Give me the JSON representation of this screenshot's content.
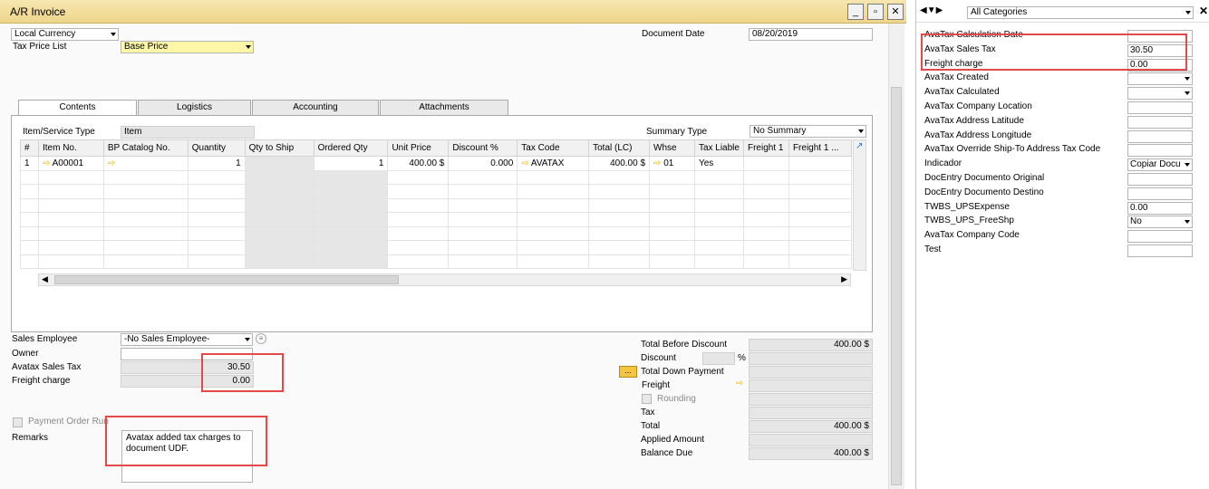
{
  "window": {
    "title": "A/R Invoice"
  },
  "header": {
    "currency": "Local Currency",
    "tax_price_list_label": "Tax Price List",
    "tax_price_list_value": "Base Price",
    "document_date_label": "Document Date",
    "document_date_value": "08/20/2019"
  },
  "tabs": [
    "Contents",
    "Logistics",
    "Accounting",
    "Attachments"
  ],
  "contents": {
    "item_type_label": "Item/Service Type",
    "item_type_value": "Item",
    "summary_type_label": "Summary Type",
    "summary_type_value": "No Summary",
    "columns": [
      "#",
      "Item No.",
      "BP Catalog No.",
      "Quantity",
      "Qty to Ship",
      "Ordered Qty",
      "Unit Price",
      "Discount %",
      "Tax Code",
      "Total (LC)",
      "Whse",
      "Tax Liable",
      "Freight 1",
      "Freight 1 ..."
    ],
    "row1": {
      "num": "1",
      "item": "A00001",
      "qty": "1",
      "ordered": "1",
      "unit_price": "400.00 $",
      "discount": "0.000",
      "tax_code": "AVATAX",
      "total": "400.00 $",
      "whse": "01",
      "tax_liable": "Yes"
    }
  },
  "footer_left": {
    "sales_employee_label": "Sales Employee",
    "sales_employee_value": "-No Sales Employee-",
    "owner_label": "Owner",
    "avatax_label": "Avatax Sales Tax",
    "avatax_value": "30.50",
    "freight_label": "Freight charge",
    "freight_value": "0.00",
    "payment_order_label": "Payment Order Run",
    "remarks_label": "Remarks",
    "remarks_value": "Avatax added tax charges to document UDF."
  },
  "totals": {
    "total_before_discount_label": "Total Before Discount",
    "total_before_discount_value": "400.00 $",
    "discount_label": "Discount",
    "percent": "%",
    "total_down_payment_label": "Total Down Payment",
    "freight_label": "Freight",
    "rounding_label": "Rounding",
    "tax_label": "Tax",
    "total_label": "Total",
    "total_value": "400.00 $",
    "applied_label": "Applied Amount",
    "balance_due_label": "Balance Due",
    "balance_due_value": "400.00 $",
    "ellipsis": "..."
  },
  "udf_panel": {
    "category": "All Categories",
    "fields": [
      {
        "label": "AvaTax Calculation Date",
        "value": ""
      },
      {
        "label": "AvaTax Sales Tax",
        "value": "30.50"
      },
      {
        "label": "Freight charge",
        "value": "0.00"
      },
      {
        "label": "AvaTax Created",
        "value": ""
      },
      {
        "label": "AvaTax Calculated",
        "value": ""
      },
      {
        "label": "AvaTax Company Location",
        "value": ""
      },
      {
        "label": "AvaTax Address Latitude",
        "value": ""
      },
      {
        "label": "AvaTax Address Longitude",
        "value": ""
      },
      {
        "label": "AvaTax Override Ship-To Address Tax Code",
        "value": ""
      },
      {
        "label": "Indicador",
        "value": "Copiar Docu"
      },
      {
        "label": "DocEntry Documento Original",
        "value": ""
      },
      {
        "label": "DocEntry Documento Destino",
        "value": ""
      },
      {
        "label": "TWBS_UPSExpense",
        "value": "0.00"
      },
      {
        "label": "TWBS_UPS_FreeShp",
        "value": "No"
      },
      {
        "label": "AvaTax Company Code",
        "value": ""
      },
      {
        "label": "Test",
        "value": ""
      }
    ]
  },
  "colors": {
    "title_bar": "#eed58a",
    "highlight": "#e54848",
    "yellow_field": "#fff6a8",
    "arrow": "#e6b800"
  }
}
